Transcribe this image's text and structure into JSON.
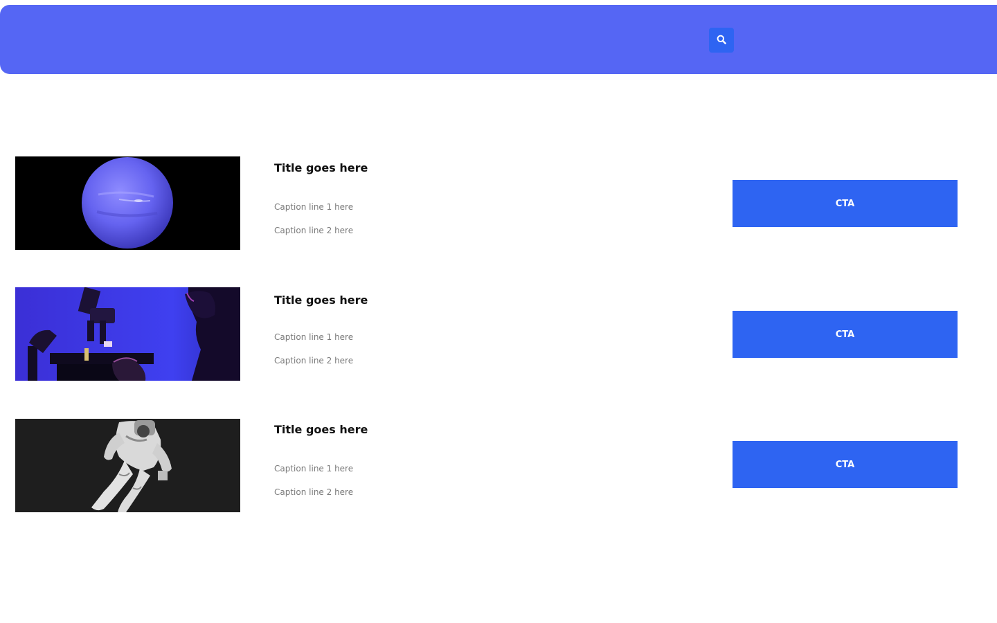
{
  "header": {
    "background_color": "#5566f4",
    "search_icon": "search-icon"
  },
  "accent_color": "#2e64f2",
  "items": [
    {
      "image": "planet-neptune-image",
      "title": "Title goes here",
      "caption_1": "Caption line 1 here",
      "caption_2": "Caption line 2 here",
      "cta_label": "CTA"
    },
    {
      "image": "microscope-scientist-image",
      "title": "Title goes here",
      "caption_1": "Caption line 1 here",
      "caption_2": "Caption line 2 here",
      "cta_label": "CTA"
    },
    {
      "image": "astronaut-spacewalk-image",
      "title": "Title goes here",
      "caption_1": "Caption line 1 here",
      "caption_2": "Caption line 2 here",
      "cta_label": "CTA"
    }
  ]
}
